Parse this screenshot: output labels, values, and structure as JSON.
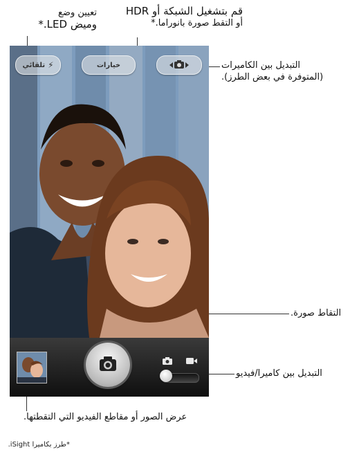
{
  "callouts": {
    "flash": {
      "line1": "تعيين وضع",
      "line2": "وميض LED.*"
    },
    "hdr": {
      "line1": "قم بتشغيل الشبكة أو HDR",
      "line2": "أو التقط صورة بانوراما.*"
    },
    "switch_cameras": {
      "line1": "التبديل بين الكاميرات",
      "line2": "(المتوفرة في بعض الطرز)."
    },
    "take_picture": "التقاط صورة.",
    "camera_video_switch": "التبديل بين كاميرا/فيديو",
    "view_photos": "عرض الصور أو مقاطع الفيديو التي التقطتها."
  },
  "camera_ui": {
    "flash_button_label": "تلقائي",
    "options_button_label": "خيارات"
  },
  "footnote": "*طرز بكاميرا iSight."
}
